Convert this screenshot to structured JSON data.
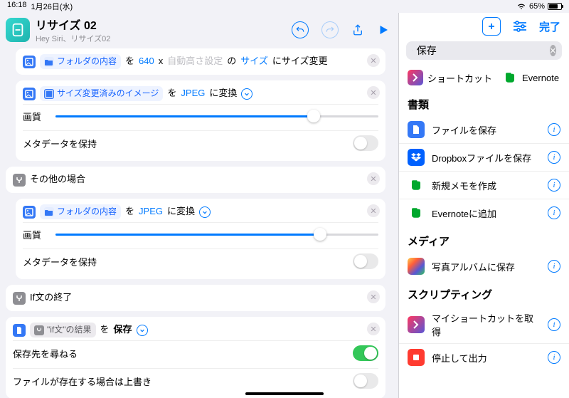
{
  "status": {
    "time": "16:18",
    "date": "1月26日(水)",
    "battery_pct": "65%"
  },
  "header": {
    "name": "リサイズ 02",
    "subtitle": "Hey Siri、リサイズ02"
  },
  "right": {
    "done": "完了",
    "search_value": "保存",
    "apps": {
      "shortcuts": "ショートカット",
      "evernote": "Evernote"
    },
    "sections": {
      "docs": "書類",
      "media": "メディア",
      "scripting": "スクリプティング"
    },
    "actions": {
      "save_file": "ファイルを保存",
      "dropbox": "Dropboxファイルを保存",
      "new_memo": "新規メモを作成",
      "evernote_add": "Evernoteに追加",
      "photo_album": "写真アルバムに保存",
      "get_shortcut": "マイショートカットを取得",
      "stop_output": "停止して出力"
    }
  },
  "editor": {
    "resize": {
      "token_folder": "フォルダの内容",
      "wo": "を",
      "width": "640",
      "x": "x",
      "auto_height": "自動高さ設定",
      "no": "の",
      "size": "サイズ",
      "suffix": "にサイズ変更"
    },
    "convert1": {
      "token_img": "サイズ変更済みのイメージ",
      "wo": "を",
      "fmt": "JPEG",
      "suffix": "に変換",
      "quality": "画質",
      "metadata": "メタデータを保持"
    },
    "else_label": "その他の場合",
    "convert2": {
      "token_folder": "フォルダの内容",
      "wo": "を",
      "fmt": "JPEG",
      "suffix": "に変換",
      "quality": "画質",
      "metadata": "メタデータを保持"
    },
    "endif": "If文の終了",
    "save": {
      "token": "\"if文\"の結果",
      "wo": "を",
      "action": "保存",
      "ask": "保存先を尋ねる",
      "overwrite": "ファイルが存在する場合は上書き"
    }
  }
}
